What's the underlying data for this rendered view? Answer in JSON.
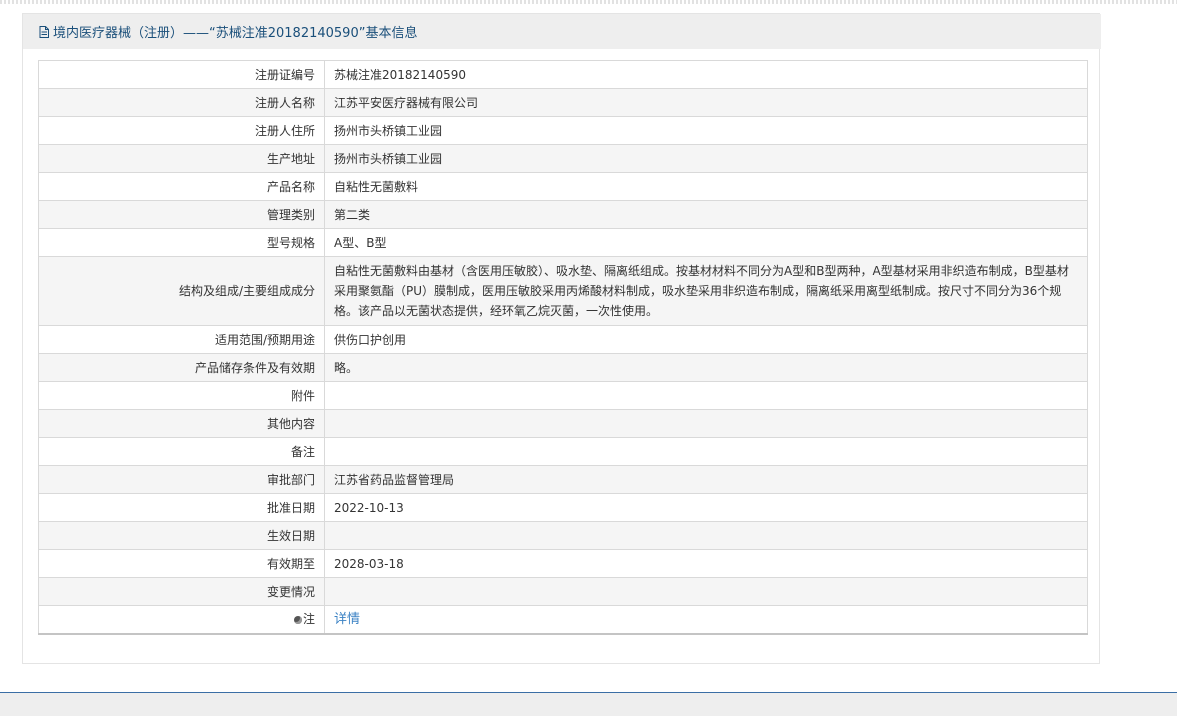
{
  "header": {
    "title": "境内医疗器械（注册）——“苏械注准20182140590”基本信息"
  },
  "rows": [
    {
      "label": "注册证编号",
      "value": "苏械注准20182140590"
    },
    {
      "label": "注册人名称",
      "value": "江苏平安医疗器械有限公司"
    },
    {
      "label": "注册人住所",
      "value": "扬州市头桥镇工业园"
    },
    {
      "label": "生产地址",
      "value": "扬州市头桥镇工业园"
    },
    {
      "label": "产品名称",
      "value": "自粘性无菌敷料"
    },
    {
      "label": "管理类别",
      "value": "第二类"
    },
    {
      "label": "型号规格",
      "value": "A型、B型"
    },
    {
      "label": "结构及组成/主要组成成分",
      "value": "自粘性无菌敷料由基材（含医用压敏胶）、吸水垫、隔离纸组成。按基材材料不同分为A型和B型两种，A型基材采用非织造布制成，B型基材采用聚氨酯（PU）膜制成，医用压敏胶采用丙烯酸材料制成，吸水垫采用非织造布制成，隔离纸采用离型纸制成。按尺寸不同分为36个规格。该产品以无菌状态提供，经环氧乙烷灭菌，一次性使用。"
    },
    {
      "label": "适用范围/预期用途",
      "value": "供伤口护创用"
    },
    {
      "label": "产品储存条件及有效期",
      "value": "略。"
    },
    {
      "label": "附件",
      "value": ""
    },
    {
      "label": "其他内容",
      "value": ""
    },
    {
      "label": "备注",
      "value": ""
    },
    {
      "label": "审批部门",
      "value": "江苏省药品监督管理局"
    },
    {
      "label": "批准日期",
      "value": "2022-10-13"
    },
    {
      "label": "生效日期",
      "value": ""
    },
    {
      "label": "有效期至",
      "value": "2028-03-18"
    },
    {
      "label": "变更情况",
      "value": ""
    },
    {
      "label": "注",
      "value": "详情"
    }
  ],
  "icons": {
    "header": "document-icon",
    "note": "note-pin-icon"
  },
  "colors": {
    "header_text": "#1a4f7a",
    "link": "#3b82c4"
  }
}
